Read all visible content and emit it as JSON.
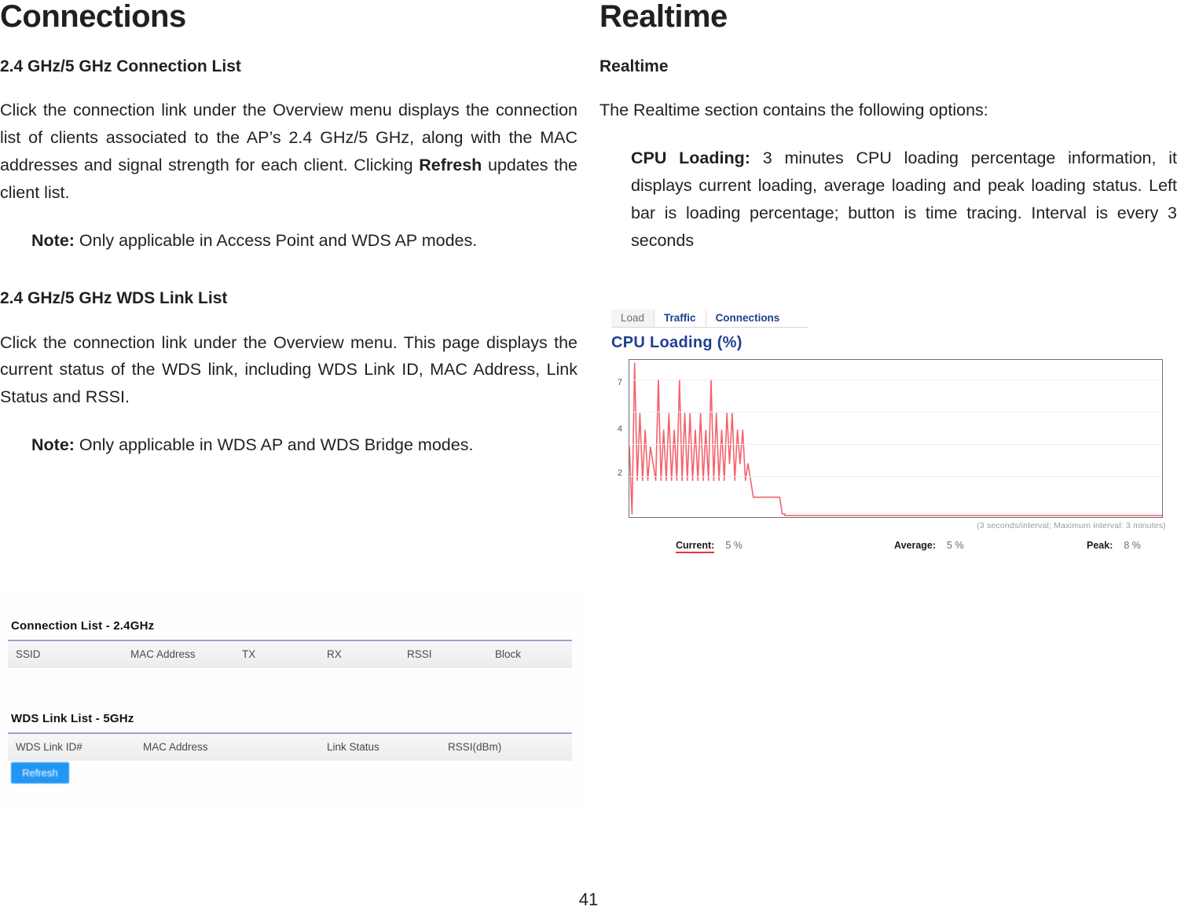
{
  "page": {
    "number": "41"
  },
  "left_column": {
    "chapter_title": "Connections",
    "section1_heading": "2.4 GHz/5 GHz Connection List",
    "section1_p1_a": "Click the connection link under the Overview menu displays the connection list of clients associated to the AP’s 2.4 GHz/5 GHz, along with the MAC addresses and signal strength for each client. Clicking ",
    "section1_p1_bold": "Refresh",
    "section1_p1_b": " updates the client list.",
    "section1_note_label": "Note:",
    "section1_note_text": " Only applicable in Access Point and WDS AP modes.",
    "section2_heading": "2.4 GHz/5 GHz WDS Link List",
    "section2_p1": "Click the connection link under the Overview menu. This page displays the current status of the WDS link, including WDS Link ID, MAC Address, Link Status and RSSI.",
    "section2_note_label": "Note:",
    "section2_note_text": " Only applicable in WDS AP and WDS Bridge modes."
  },
  "right_column": {
    "chapter_title": "Realtime",
    "section_heading": "Realtime",
    "intro": "The Realtime section contains the following options:",
    "cpu_loading_label": "CPU Loading:",
    "cpu_loading_text": " 3 minutes CPU loading percentage information, it displays current loading, average loading and peak loading status. Left bar is loading percentage; button is time tracing. Interval is every 3 seconds"
  },
  "connection_screenshot": {
    "connection_list": {
      "title": "Connection List - 2.4GHz",
      "columns": [
        "SSID",
        "MAC Address",
        "TX",
        "RX",
        "RSSI",
        "Block"
      ]
    },
    "wds_link_list": {
      "title": "WDS Link List - 5GHz",
      "columns": [
        "WDS Link ID#",
        "MAC Address",
        "Link Status",
        "RSSI(dBm)"
      ]
    },
    "refresh_button_label": "Refresh",
    "accent_color": "#2196f3"
  },
  "realtime_screenshot": {
    "tabs": [
      {
        "label": "Load",
        "active": true
      },
      {
        "label": "Traffic",
        "active": false
      },
      {
        "label": "Connections",
        "active": false
      }
    ],
    "axis_note": "(3 seconds/interval; Maximum interval: 3 minutes)",
    "stats": [
      {
        "label": "Current:",
        "value": "5 %"
      },
      {
        "label": "Average:",
        "value": "5 %"
      },
      {
        "label": "Peak:",
        "value": "8 %"
      }
    ],
    "title_color": "#1f3f8f",
    "line_color": "#f4626c"
  },
  "chart_data": {
    "type": "line",
    "title": "CPU Loading (%)",
    "xlabel": "",
    "ylabel": "",
    "ylim": [
      0,
      9
    ],
    "yticks": [
      2,
      4,
      7
    ],
    "grid": true,
    "legend": "none",
    "x": [
      0,
      1,
      2,
      3,
      4,
      5,
      6,
      7,
      8,
      9,
      10,
      11,
      12,
      13,
      14,
      15,
      16,
      17,
      18,
      19,
      20,
      21,
      22,
      23,
      24,
      25,
      26,
      27,
      28,
      29,
      30,
      31,
      32,
      33,
      34,
      35,
      36,
      37,
      38,
      39,
      40,
      41,
      42,
      43,
      44,
      45,
      46,
      47,
      48,
      49,
      50,
      51,
      52,
      53,
      54,
      55,
      56,
      57,
      58,
      59
    ],
    "series": [
      {
        "name": "CPU Loading",
        "values": [
          4,
          0,
          9,
          2,
          6,
          2,
          5,
          2,
          4,
          3,
          2,
          8,
          2,
          5,
          2,
          6,
          2,
          5,
          2,
          8,
          2,
          6,
          2,
          6,
          2,
          5,
          2,
          6,
          2,
          5,
          2,
          8,
          2,
          6,
          2,
          5,
          2,
          6,
          3,
          6,
          2,
          5,
          3,
          5,
          2,
          3,
          2,
          1,
          1,
          1,
          1,
          1,
          1,
          1,
          1,
          1,
          1,
          1,
          0,
          0
        ]
      }
    ]
  }
}
